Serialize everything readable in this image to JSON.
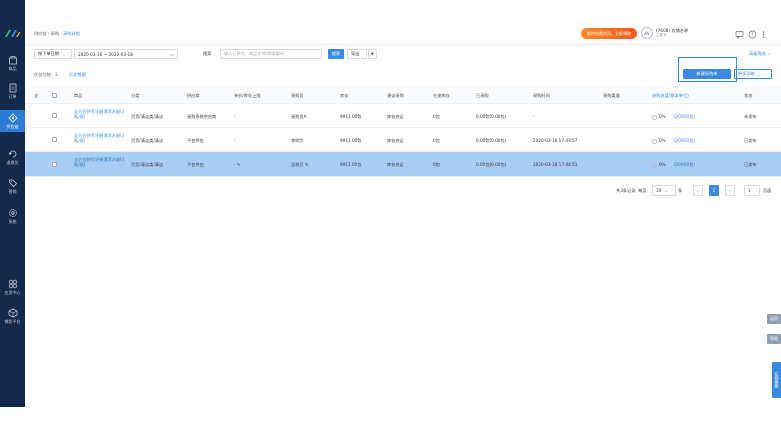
{
  "sidebar": {
    "items": [
      {
        "label": "商品",
        "icon": "box-icon"
      },
      {
        "label": "订单",
        "icon": "order-icon"
      },
      {
        "label": "供应链",
        "icon": "supply-chain-icon",
        "active": true
      },
      {
        "label": "退换货",
        "icon": "return-icon"
      },
      {
        "label": "营销",
        "icon": "tag-icon"
      },
      {
        "label": "系统",
        "icon": "gear-icon"
      },
      {
        "label": "应用中心",
        "icon": "apps-icon"
      },
      {
        "label": "铺货平台",
        "icon": "cube-icon"
      }
    ]
  },
  "header": {
    "breadcrumb": [
      "供应链",
      "采购",
      "采购计划"
    ],
    "promo": "限时免费试用，立即领取",
    "store_name": "(760B) 店铺名称",
    "store_sub": "主账号",
    "avatar_text": "AV"
  },
  "filters": {
    "date_type": "按下单日期",
    "date_range": "2020-03-16 ~ 2020-03-18",
    "search_label": "搜索",
    "search_placeholder": "输入订单号、商品名称/商家编码",
    "search_button": "搜索",
    "export_button": "导出",
    "advanced_link": "高级筛选"
  },
  "actions": {
    "summary_label": "任务总数：",
    "summary_count": "3",
    "history_link": "历史数据",
    "create_button": "新建采购单",
    "more_button": "更多功能"
  },
  "table": {
    "headers": [
      "全",
      "",
      "商品",
      "分类",
      "供应商",
      "单价/库存上限",
      "采购员",
      "库存",
      "建议采购",
      "在途库存",
      "已采购",
      "采购时间",
      "采购渠道",
      "采购进度(基本单位)",
      "状态"
    ],
    "rows": [
      {
        "product": "全方位特写牙刷漂浮水玻(1瓶/瓶)",
        "category": "百货/清洁类/清洁",
        "supplier": "采购系统供应商",
        "price": "-",
        "buyer": "采购员A",
        "stock": "9911.00包",
        "suggest": "库存充足",
        "transit": "0包",
        "purchased": "0.00包(0.00包)",
        "time": "-",
        "channel": "",
        "progress": "0%",
        "progress_detail": "0/0(0/0包)",
        "status": "未发布",
        "selected": false
      },
      {
        "product": "全方位特写牙刷漂浮水玻(1瓶/瓶)",
        "category": "百货/清洁类/清洁",
        "supplier": "平台供应",
        "price": "-",
        "buyer": "李明华",
        "stock": "9911.00包",
        "suggest": "库存充足",
        "transit": "0包",
        "purchased": "0.00包(0.00包)",
        "time": "2020-03-18 17:43:57",
        "channel": "",
        "progress": "0%",
        "progress_detail": "0/0(0/0包)",
        "status": "已发布",
        "selected": false
      },
      {
        "product": "全方位特写牙刷漂浮水玻(1瓶/瓶)",
        "category": "百货/清洁类/清洁",
        "supplier": "平台供应",
        "price": "-",
        "buyer": "吴梓豆",
        "stock": "9911.00包",
        "suggest": "库存充足",
        "transit": "0包",
        "purchased": "0.00包(0.00包)",
        "time": "2020-03-18 17:44:51",
        "channel": "",
        "progress": "0%",
        "progress_detail": "0/0(0/0包)",
        "status": "已发布",
        "selected": true
      }
    ]
  },
  "pager": {
    "summary": "共3条记录, 每页",
    "page_size": "10",
    "unit": "条",
    "current": "1",
    "jump_value": "1",
    "go_label": "页面"
  },
  "floats": {
    "top": "返回",
    "middle": "帮助",
    "bottom": "在线客服"
  }
}
